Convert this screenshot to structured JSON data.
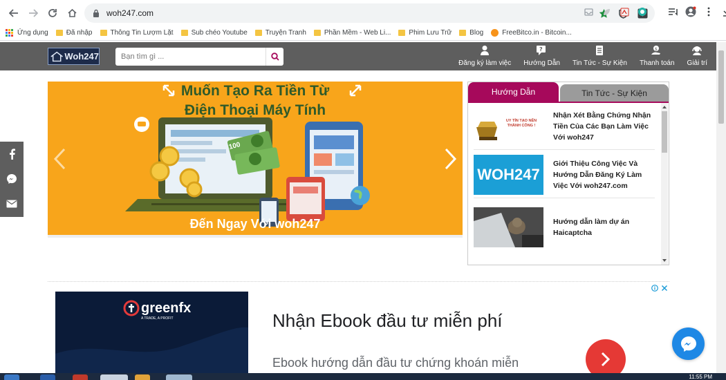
{
  "browser": {
    "url": "woh247.com",
    "bookmarks": [
      {
        "label": "Ứng dụng",
        "kind": "apps"
      },
      {
        "label": "Đã nhập",
        "kind": "folder"
      },
      {
        "label": "Thông Tin Lượm Lặt",
        "kind": "folder"
      },
      {
        "label": "Sub chéo Youtube",
        "kind": "folder"
      },
      {
        "label": "Truyện Tranh",
        "kind": "folder"
      },
      {
        "label": "Phần Mềm - Web Li...",
        "kind": "folder"
      },
      {
        "label": "Phim Lưu Trữ",
        "kind": "folder"
      },
      {
        "label": "Blog",
        "kind": "folder"
      },
      {
        "label": "FreeBitco.in - Bitcoin...",
        "kind": "bitcoin"
      }
    ]
  },
  "site": {
    "logo_text": "Woh247",
    "search_placeholder": "Bạn tìm gì ...",
    "nav": [
      {
        "label": "Đăng ký làm việc",
        "icon": "user-icon"
      },
      {
        "label": "Hướng Dẫn",
        "icon": "help-chat-icon"
      },
      {
        "label": "Tin Tức - Sự Kiện",
        "icon": "document-icon"
      },
      {
        "label": "Thanh toán",
        "icon": "payment-icon"
      },
      {
        "label": "Giải trí",
        "icon": "headset-icon"
      }
    ]
  },
  "slider": {
    "title_line1": "Muốn Tạo Ra Tiền Từ",
    "title_line2": "Điện Thoại Máy Tính",
    "caption": "Đến Ngay Với woh247",
    "money_label": "100"
  },
  "sidebar": {
    "tab_active": "Hướng Dẫn",
    "tab_inactive": "Tin Tức - Sự Kiện",
    "posts": [
      {
        "title": "Nhận Xét Bằng Chứng Nhận Tiền Của Các Bạn Làm Việc Với woh247",
        "thumb_text": "UY TÍN TẠO NÊN THÀNH CÔNG !"
      },
      {
        "title": "Giới Thiệu Công Việc Và Hướng Dẫn Đăng Ký Làm Việc Với woh247.com",
        "thumb_text": "WOH247"
      },
      {
        "title": "Hướng dẫn làm dự án Haicaptcha",
        "thumb_text": ""
      }
    ]
  },
  "ad": {
    "brand": "greenfx",
    "brand_tagline": "A TRADE, A PROFIT",
    "headline": "Nhận Ebook đầu tư miễn phí",
    "body": "Ebook hướng dẫn đầu tư chứng khoán miễn"
  },
  "taskbar": {
    "clock": "11:55 PM"
  },
  "colors": {
    "site_header": "#5e5e5e",
    "accent": "#a6095b",
    "slider_bg": "#f8a51b",
    "ad_cta": "#e53935",
    "messenger": "#1e88e5"
  }
}
